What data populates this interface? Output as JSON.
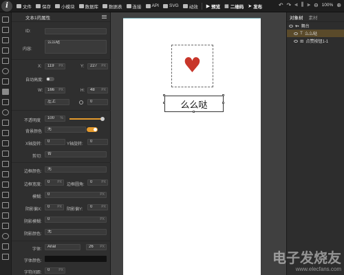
{
  "toolbar": {
    "logo_glyph": "i",
    "items": [
      {
        "label": "文件",
        "icon": "file-icon"
      },
      {
        "label": "保存",
        "icon": "save-icon"
      },
      {
        "label": "小模块",
        "icon": "module-icon"
      },
      {
        "label": "数据库",
        "icon": "database-icon"
      },
      {
        "label": "数据表",
        "icon": "table-icon"
      },
      {
        "label": "连接",
        "icon": "link-icon"
      },
      {
        "label": "API",
        "icon": "api-icon"
      },
      {
        "label": "SVG",
        "icon": "svg-icon"
      },
      {
        "label": "动效",
        "icon": "animation-icon"
      }
    ],
    "actions": {
      "preview": "预览",
      "qrcode": "二维码",
      "publish": "发布"
    },
    "zoom": "100%"
  },
  "properties": {
    "title": "文本1的属性",
    "id_label": "ID:",
    "id_value": "",
    "content_label": "内容:",
    "content_value": "么么哒",
    "x_label": "X:",
    "x_value": "119",
    "y_label": "Y:",
    "y_value": "227",
    "px": "PX",
    "auto_height_label": "自动高度:",
    "w_label": "W:",
    "w_value": "166",
    "h_label": "H:",
    "h_value": "48",
    "anchor_value": "左上",
    "rotate_value": "0",
    "opacity_label": "不透明度",
    "opacity_value": "100",
    "percent": "%",
    "bgcolor_label": "背景颜色",
    "bgcolor_value": "无",
    "xrot_label": "X轴旋转:",
    "xrot_value": "0",
    "yrot_label": "Y轴旋转:",
    "yrot_value": "0",
    "clip_label": "剪切:",
    "clip_value": "否",
    "border_color_label": "边框颜色:",
    "border_color_value": "无",
    "border_width_label": "边框宽度:",
    "border_width_value": "0",
    "radius_label": "边框圆角:",
    "radius_value": "0",
    "blur_label": "模糊:",
    "blur_value": "0",
    "shadow_x_label": "阴影偏X:",
    "shadow_x_value": "0",
    "shadow_y_label": "阴影偏Y:",
    "shadow_y_value": "0",
    "shadow_blur_label": "阴影模糊:",
    "shadow_blur_value": "0",
    "shadow_color_label": "阴影颜色:",
    "shadow_color_value": "无",
    "font_label": "字体:",
    "font_value": "Arial",
    "font_size_value": "26",
    "font_color_label": "字体颜色:",
    "letter_spacing_label": "字符间距:",
    "letter_spacing_value": "0"
  },
  "canvas": {
    "heart_glyph": "♥",
    "text": "么么哒",
    "heart_color": "#c8362a"
  },
  "layers": {
    "tabs": [
      "对象树",
      "素材"
    ],
    "rows": [
      {
        "label": "舞台",
        "icon": "folder-icon"
      },
      {
        "label": "么么哒",
        "icon": "text-icon"
      },
      {
        "label": "点赞按钮1-1",
        "icon": "component-icon"
      }
    ]
  },
  "watermark": {
    "logo": "电子发烧友",
    "url": "www.elecfans.com"
  },
  "colors": {
    "accent": "#e59a2d",
    "background": "#2b2b2b",
    "stage": "#ffffff"
  }
}
